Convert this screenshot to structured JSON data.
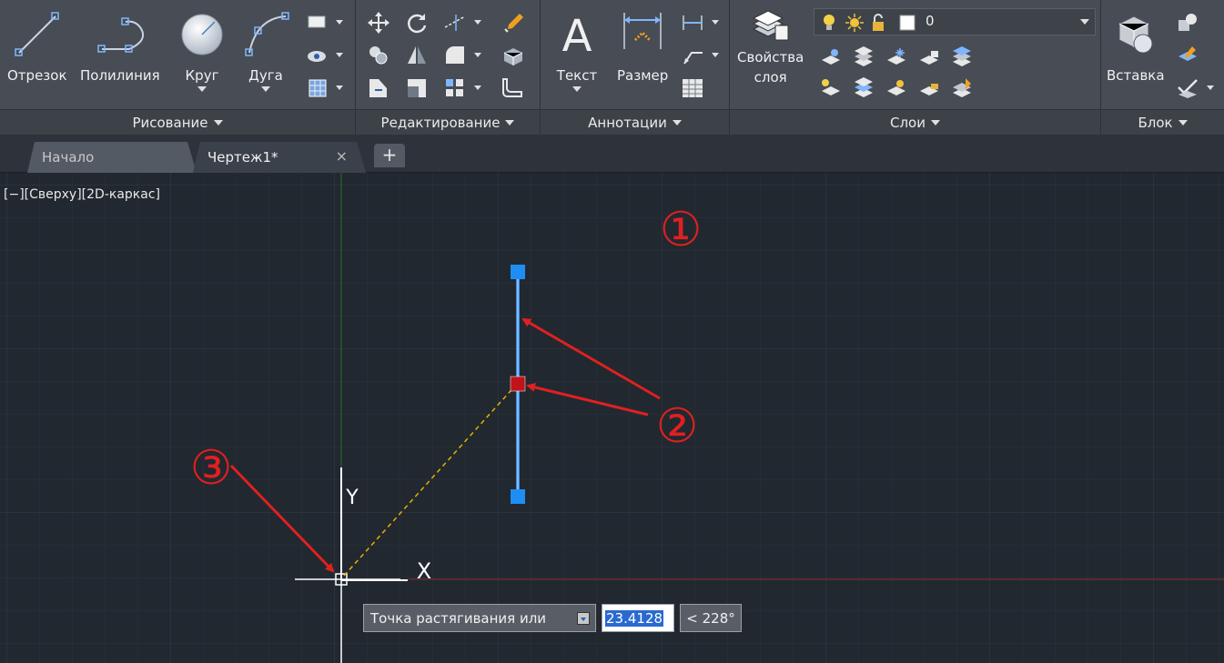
{
  "ribbon": {
    "draw": {
      "title": "Рисование",
      "tools": {
        "line": "Отрезок",
        "polyline": "Полилиния",
        "circle": "Круг",
        "arc": "Дуга"
      }
    },
    "modify": {
      "title": "Редактирование"
    },
    "annotation": {
      "title": "Аннотации",
      "tools": {
        "text": "Текст",
        "dimension": "Размер"
      }
    },
    "layers": {
      "title": "Слои",
      "properties_line1": "Свойства",
      "properties_line2": "слоя",
      "current_layer": "0"
    },
    "block": {
      "title": "Блок",
      "insert": "Вставка"
    }
  },
  "tabs": {
    "home": "Начало",
    "drawing": "Чертеж1*",
    "close_glyph": "×",
    "add_glyph": "+"
  },
  "viewport": {
    "controls": "[−][Сверху][2D-каркас]",
    "ucs_x": "X",
    "ucs_y": "Y",
    "callouts": [
      "①",
      "②",
      "③"
    ]
  },
  "dynamic_input": {
    "prompt": "Точка растягивания или",
    "distance": "23.4128",
    "angle": "< 228°"
  },
  "colors": {
    "canvas": "#212830",
    "grid": "#2b333d",
    "x_axis": "#8a2a2a",
    "y_axis": "#2f6a2f",
    "selected_line": "#3b8de6",
    "grip": "#1e8ef5",
    "hot_grip": "#c0141a",
    "rubber_band": "#e6b000",
    "annotation": "#e02020"
  }
}
